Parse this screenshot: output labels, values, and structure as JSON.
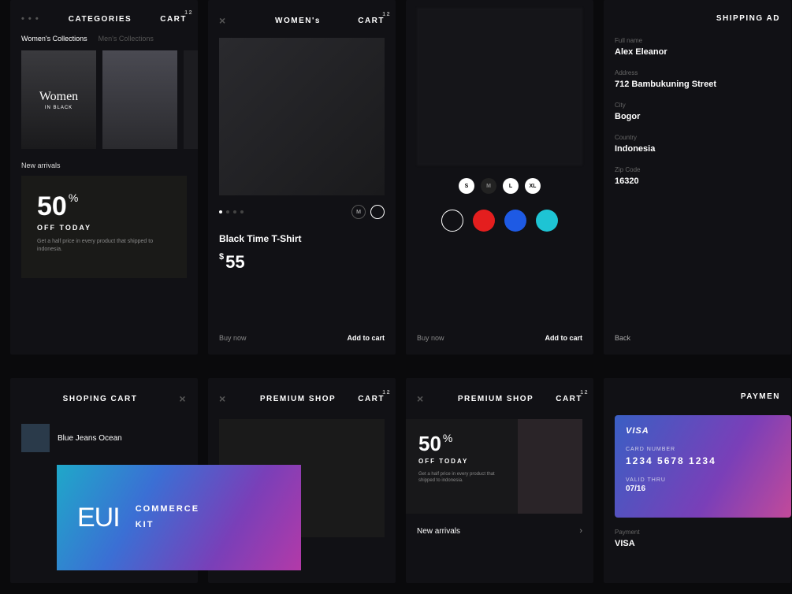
{
  "row1": {
    "categories": {
      "menu": "• • •",
      "title": "CATEGORIES",
      "cart": "CART",
      "cartCount": "12",
      "tabs": [
        "Women's Collections",
        "Men's Collections"
      ],
      "cards": [
        {
          "title": "Women",
          "sub": "IN BLACK"
        }
      ],
      "newArrivals": "New arrivals",
      "promo": {
        "big": "50",
        "pct": "%",
        "sub": "OFF TODAY",
        "desc": "Get a half price in every product that shipped to indonesia."
      }
    },
    "product": {
      "close": "×",
      "title": "WOMEN's",
      "cart": "CART",
      "cartCount": "12",
      "sizes": [
        "M"
      ],
      "name": "Black Time T-Shirt",
      "currency": "$",
      "price": "55",
      "buyNow": "Buy now",
      "addToCart": "Add to cart"
    },
    "variant": {
      "sizes": [
        "S",
        "M",
        "L",
        "XL"
      ],
      "colors": [
        "#000",
        "#e41e1e",
        "#1e5ae4",
        "#1ec4d4"
      ],
      "buyNow": "Buy now",
      "addToCart": "Add to cart"
    },
    "shipping": {
      "title": "SHIPPING AD",
      "fields": [
        {
          "label": "Full name",
          "value": "Alex Eleanor"
        },
        {
          "label": "Address",
          "value": "712 Bambukuning Street"
        },
        {
          "label": "City",
          "value": "Bogor"
        },
        {
          "label": "Country",
          "value": "Indonesia"
        },
        {
          "label": "Zip Code",
          "value": "16320"
        }
      ],
      "back": "Back"
    }
  },
  "row2": {
    "cart": {
      "title": "SHOPING CART",
      "close": "×",
      "items": [
        {
          "name": "Blue Jeans Ocean"
        }
      ]
    },
    "premium1": {
      "close": "×",
      "title": "PREMIUM SHOP",
      "cart": "CART",
      "cartCount": "12"
    },
    "premium2": {
      "close": "×",
      "title": "PREMIUM SHOP",
      "cart": "CART",
      "cartCount": "12",
      "promo": {
        "big": "50",
        "pct": "%",
        "sub": "OFF TODAY",
        "desc": "Get a half price in every product that shipped to indonesia."
      },
      "newArrivals": "New arrivals"
    },
    "payment": {
      "title": "PAYMEN",
      "visa": {
        "brand": "VISA",
        "numLabel": "CARD NUMBER",
        "num": "1234 5678 1234",
        "thruLabel": "VALID THRU",
        "thru": "07/16"
      },
      "payLabel": "Payment",
      "payValue": "VISA"
    }
  },
  "eui": {
    "logo": "EUI",
    "line1": "COMMERCE",
    "line2": "KIT"
  }
}
